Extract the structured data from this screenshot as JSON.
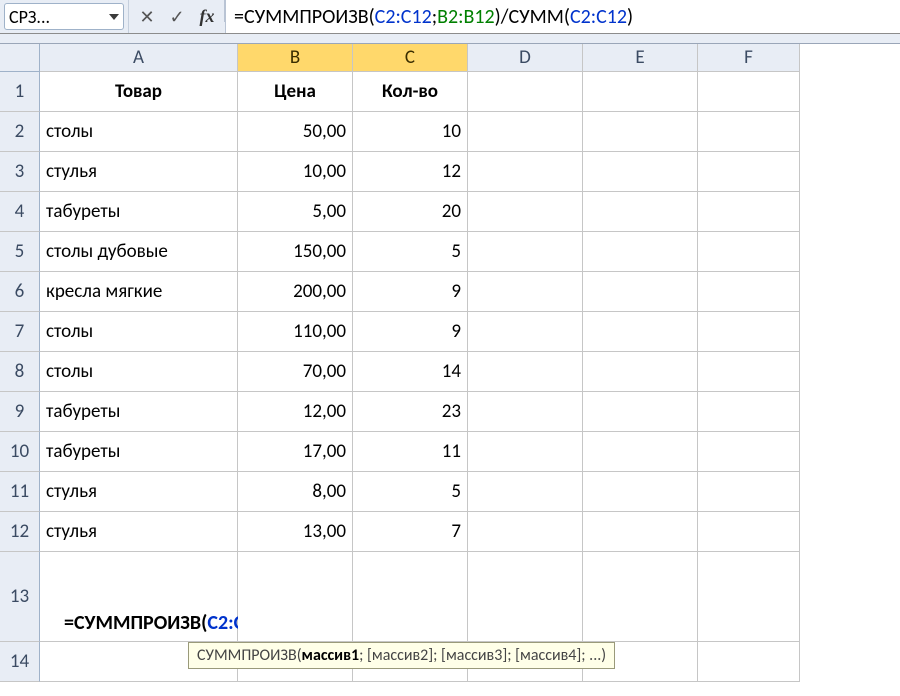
{
  "name_box": "СРЗ...",
  "fb_icons": {
    "cancel": "✕",
    "enter": "✓",
    "fx": "fx"
  },
  "formula": {
    "eq": "=",
    "fn1": "СУММПРОИЗВ",
    "open": "(",
    "r1": "C2:C12",
    "sep": ";",
    "r2": "B2:B12",
    "close": ")",
    "div": "/",
    "fn2": "СУММ",
    "r3": "C2:C12"
  },
  "columns": [
    "A",
    "B",
    "C",
    "D",
    "E",
    "F"
  ],
  "rows": [
    "1",
    "2",
    "3",
    "4",
    "5",
    "6",
    "7",
    "8",
    "9",
    "10",
    "11",
    "12",
    "13",
    "14"
  ],
  "head": {
    "a": "Товар",
    "b": "Цена",
    "c": "Кол-во"
  },
  "data": [
    {
      "a": "столы",
      "b": "50,00",
      "c": "10"
    },
    {
      "a": "стулья",
      "b": "10,00",
      "c": "12"
    },
    {
      "a": "табуреты",
      "b": "5,00",
      "c": "20"
    },
    {
      "a": "столы дубовые",
      "b": "150,00",
      "c": "5"
    },
    {
      "a": "кресла мягкие",
      "b": "200,00",
      "c": "9"
    },
    {
      "a": "столы",
      "b": "110,00",
      "c": "9"
    },
    {
      "a": "столы",
      "b": "70,00",
      "c": "14"
    },
    {
      "a": "табуреты",
      "b": "12,00",
      "c": "23"
    },
    {
      "a": "табуреты",
      "b": "17,00",
      "c": "11"
    },
    {
      "a": "стулья",
      "b": "8,00",
      "c": "5"
    },
    {
      "a": "стулья",
      "b": "13,00",
      "c": "7"
    }
  ],
  "tooltip": {
    "fn": "СУММПРОИЗВ",
    "args": "(массив1; [массив2]; [массив3]; [массив4]; ...)",
    "bold_arg": "массив1"
  }
}
